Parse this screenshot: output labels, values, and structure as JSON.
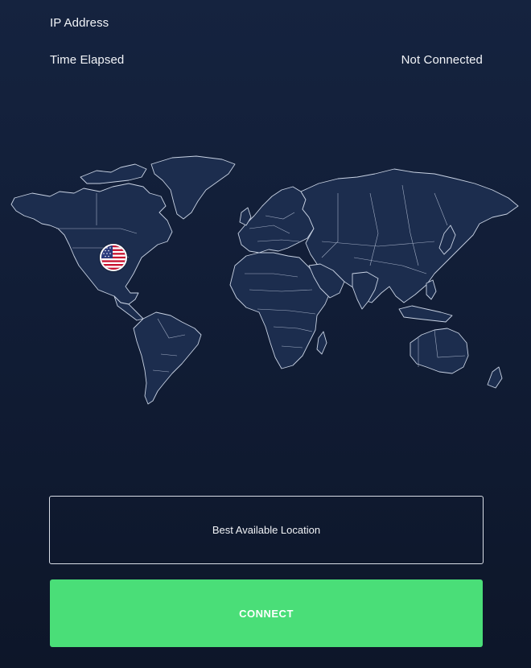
{
  "header": {
    "ip_label": "IP Address",
    "time_label": "Time Elapsed",
    "status": "Not Connected"
  },
  "map": {
    "icon": "world-map",
    "selected_country_flag": "us-flag-icon"
  },
  "location": {
    "label": "Best Available Location"
  },
  "connect": {
    "label": "CONNECT"
  },
  "colors": {
    "background_top": "#15233f",
    "background_bottom": "#0d1629",
    "land": "#1c2d4e",
    "connect_green": "#4ade78"
  }
}
